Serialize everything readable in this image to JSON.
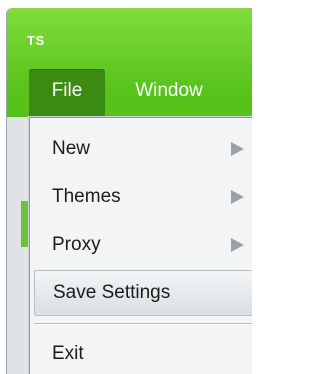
{
  "app": {
    "logo_text": "TS"
  },
  "menubar": {
    "items": [
      {
        "label": "File",
        "state": "open"
      },
      {
        "label": "Window",
        "state": "closed"
      }
    ]
  },
  "file_menu": {
    "items": [
      {
        "label": "New",
        "has_submenu": true
      },
      {
        "label": "Themes",
        "has_submenu": true
      },
      {
        "label": "Proxy",
        "has_submenu": true
      },
      {
        "label": "Save Settings",
        "has_submenu": false,
        "highlighted": true
      },
      {
        "label": "Exit",
        "has_submenu": false
      }
    ]
  },
  "colors": {
    "titlebar": "#56c21a",
    "active_menu": "#3b8a12",
    "menu_background": "#f2f4f5",
    "submenu_arrow": "#9aa0a4"
  }
}
